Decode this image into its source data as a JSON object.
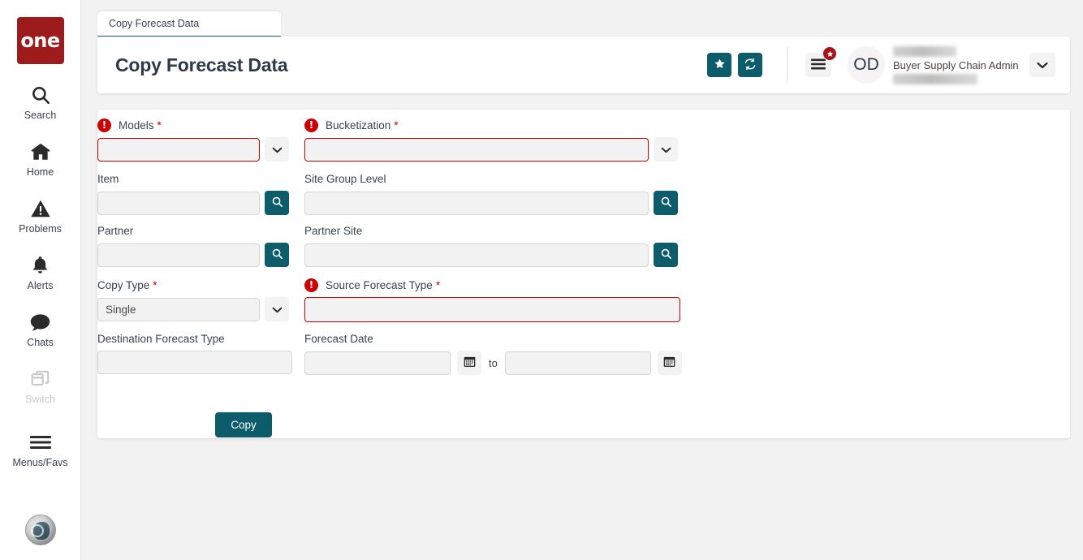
{
  "colors": {
    "brand_red": "#9e1b1b",
    "teal": "#0d5c6b",
    "error_red": "#cc0000",
    "badge_red": "#a8121b",
    "page_bg": "#f2f2f2",
    "field_bg": "#f2f2f2"
  },
  "rail": {
    "brand_label": "one",
    "items": [
      {
        "label": "Search",
        "icon": "search-icon",
        "disabled": false
      },
      {
        "label": "Home",
        "icon": "home-icon",
        "disabled": false
      },
      {
        "label": "Problems",
        "icon": "warning-icon",
        "disabled": false
      },
      {
        "label": "Alerts",
        "icon": "bell-icon",
        "disabled": false
      },
      {
        "label": "Chats",
        "icon": "chat-icon",
        "disabled": false
      },
      {
        "label": "Switch",
        "icon": "switch-icon",
        "disabled": true
      },
      {
        "label": "Menus/Favs",
        "icon": "hamburger-icon",
        "disabled": false
      }
    ],
    "avatar_icon": "user-avatar-icon"
  },
  "tab": {
    "label": "Copy Forecast Data"
  },
  "header": {
    "title": "Copy Forecast Data",
    "favorite_icon": "star-icon",
    "refresh_icon": "refresh-icon",
    "menu_icon": "hamburger-icon",
    "menu_badge_icon": "star-badge-icon",
    "avatar_initials": "OD",
    "user_role": "Buyer Supply Chain Admin",
    "caret_icon": "chevron-down-icon"
  },
  "form": {
    "models": {
      "label": "Models",
      "required": true,
      "error": true,
      "value": "",
      "placeholder": "",
      "control": "dropdown"
    },
    "bucketization": {
      "label": "Bucketization",
      "required": true,
      "error": true,
      "value": "",
      "placeholder": "",
      "control": "dropdown"
    },
    "item": {
      "label": "Item",
      "required": false,
      "error": false,
      "value": "",
      "placeholder": "",
      "control": "search"
    },
    "site_group": {
      "label": "Site Group Level",
      "required": false,
      "error": false,
      "value": "",
      "placeholder": "",
      "control": "search"
    },
    "partner": {
      "label": "Partner",
      "required": false,
      "error": false,
      "value": "",
      "placeholder": "",
      "control": "search"
    },
    "partner_site": {
      "label": "Partner Site",
      "required": false,
      "error": false,
      "value": "",
      "placeholder": "",
      "control": "search"
    },
    "copy_type": {
      "label": "Copy Type",
      "required": true,
      "error": false,
      "value": "Single",
      "placeholder": "",
      "control": "dropdown"
    },
    "source_ft": {
      "label": "Source Forecast Type",
      "required": true,
      "error": true,
      "value": "",
      "placeholder": "",
      "control": "text"
    },
    "dest_ft": {
      "label": "Destination Forecast Type",
      "required": false,
      "error": false,
      "value": "",
      "placeholder": "",
      "control": "text"
    },
    "forecast_date": {
      "label": "Forecast Date",
      "required": false,
      "error": false,
      "from_value": "",
      "to_value": "",
      "separator": "to",
      "calendar_icon": "calendar-icon"
    },
    "submit_label": "Copy"
  }
}
